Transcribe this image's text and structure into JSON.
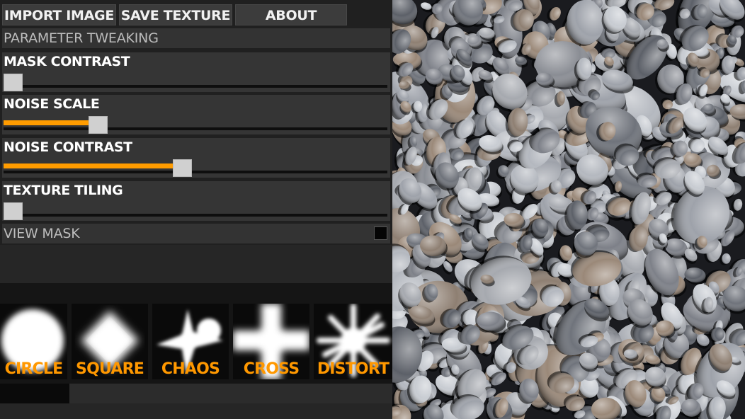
{
  "toolbar": {
    "import_label": "IMPORT IMAGE",
    "save_label": "SAVE TEXTURE",
    "about_label": "ABOUT"
  },
  "panel": {
    "title": "PARAMETER TWEAKING",
    "view_mask_label": "VIEW MASK",
    "view_mask_checked": false
  },
  "parameters": [
    {
      "label": "MASK CONTRAST",
      "value": 0.0
    },
    {
      "label": "NOISE SCALE",
      "value": 0.23
    },
    {
      "label": "NOISE CONTRAST",
      "value": 0.46
    },
    {
      "label": "TEXTURE TILING",
      "value": 0.0
    }
  ],
  "shapes": [
    {
      "label": "CIRCLE",
      "icon": "circle-mask-icon"
    },
    {
      "label": "SQUARE",
      "icon": "square-mask-icon"
    },
    {
      "label": "CHAOS",
      "icon": "chaos-mask-icon"
    },
    {
      "label": "CROSS",
      "icon": "cross-mask-icon"
    },
    {
      "label": "DISTORT",
      "icon": "distort-mask-icon"
    }
  ],
  "colors": {
    "accent": "#ff9c00",
    "panel_bg": "#202020",
    "button_bg": "#3c3c3c"
  },
  "preview": {
    "image": "pebble-texture-preview"
  }
}
